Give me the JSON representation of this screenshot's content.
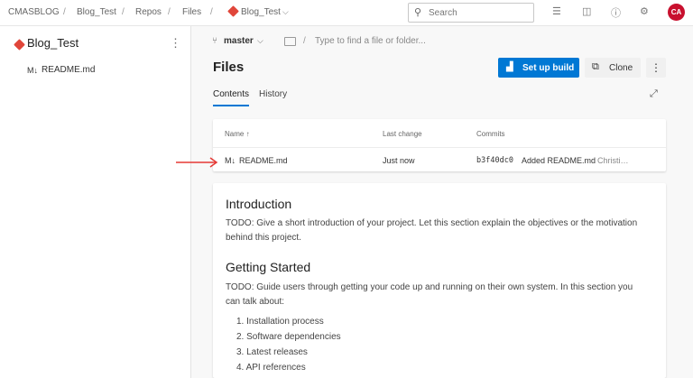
{
  "breadcrumb": [
    "CMASBLOG",
    "Blog_Test",
    "Repos",
    "Files",
    "Blog_Test"
  ],
  "search": {
    "placeholder": "Search"
  },
  "user": {
    "initials": "CA"
  },
  "sidebar": {
    "repo_name": "Blog_Test",
    "items": [
      {
        "icon": "M↓",
        "label": "README.md"
      }
    ]
  },
  "toolbar": {
    "branch": "master",
    "path_placeholder": "Type to find a file or folder..."
  },
  "page": {
    "title": "Files",
    "setup_build": "Set up build",
    "clone": "Clone",
    "tabs": [
      "Contents",
      "History"
    ]
  },
  "table": {
    "headers": {
      "name": "Name ↑",
      "last_change": "Last change",
      "commits": "Commits"
    },
    "rows": [
      {
        "icon": "M↓",
        "name": "README.md",
        "last_change": "Just now",
        "commit_id": "b3f40dc0",
        "message": "Added README.md",
        "author": "Christi…"
      }
    ]
  },
  "readme": {
    "intro_heading": "Introduction",
    "intro_text": "TODO: Give a short introduction of your project. Let this section explain the objectives or the motivation behind this project.",
    "gs_heading": "Getting Started",
    "gs_text": "TODO: Guide users through getting your code up and running on their own system. In this section you can talk about:",
    "list": [
      "1. Installation process",
      "2. Software dependencies",
      "3. Latest releases",
      "4. API references"
    ]
  },
  "colors": {
    "accent": "#0078d4",
    "repo": "#e0463a",
    "avatar": "#c8102e",
    "annotation_arrow": "#e53935"
  }
}
